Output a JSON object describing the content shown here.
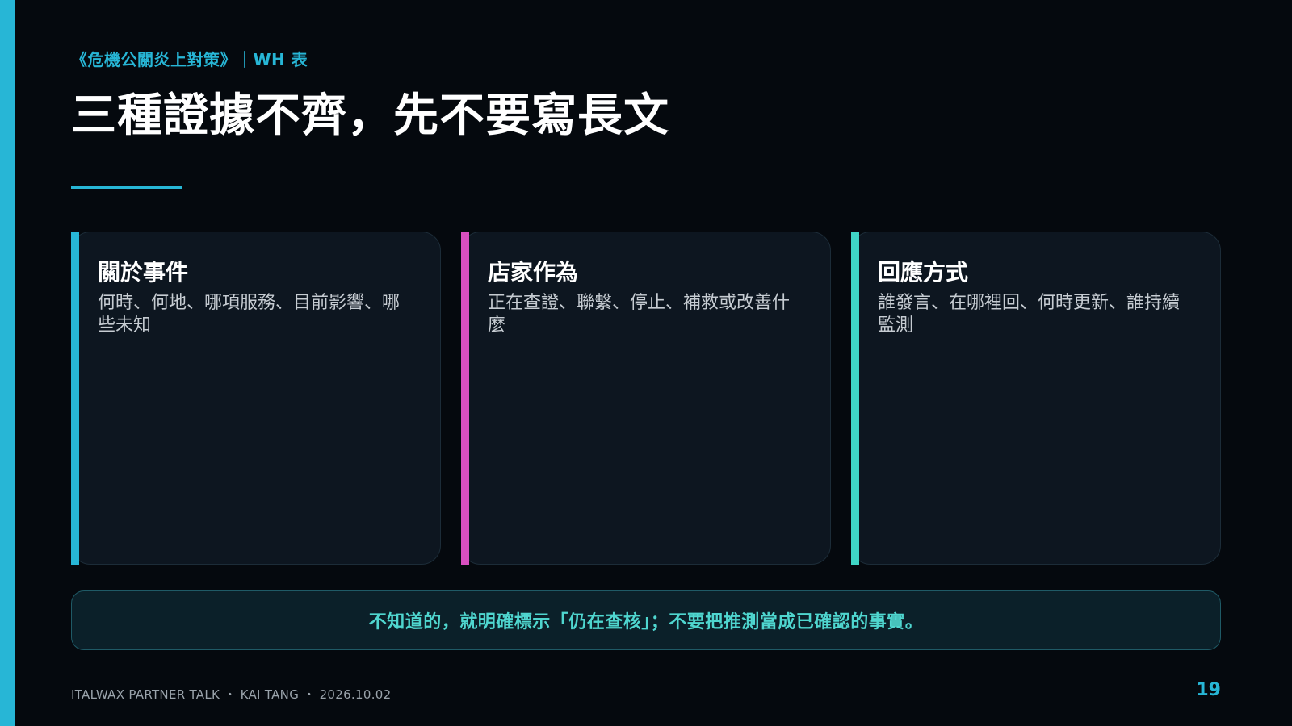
{
  "header": {
    "kicker": "《危機公關炎上對策》｜WH 表",
    "title": "三種證據不齊，先不要寫長文"
  },
  "cards": [
    {
      "title": "關於事件",
      "body": "何時、何地、哪項服務、目前影響、哪些未知",
      "accent_color": "#27b6d6"
    },
    {
      "title": "店家作為",
      "body": "正在查證、聯繫、停止、補救或改善什麼",
      "accent_color": "#d94fc0"
    },
    {
      "title": "回應方式",
      "body": "誰發言、在哪裡回、何時更新、誰持續監測",
      "accent_color": "#3fd6c6"
    }
  ],
  "callout": {
    "text": "不知道的，就明確標示「仍在查核」；不要把推測當成已確認的事實。"
  },
  "footer": {
    "text": "ITALWAX PARTNER TALK ・ KAI TANG ・ 2026.10.02",
    "page_number": "19"
  },
  "colors": {
    "background": "#05090e",
    "primary_accent": "#27b6d6",
    "card_background": "#0d1620",
    "callout_text": "#4fd6cf"
  }
}
